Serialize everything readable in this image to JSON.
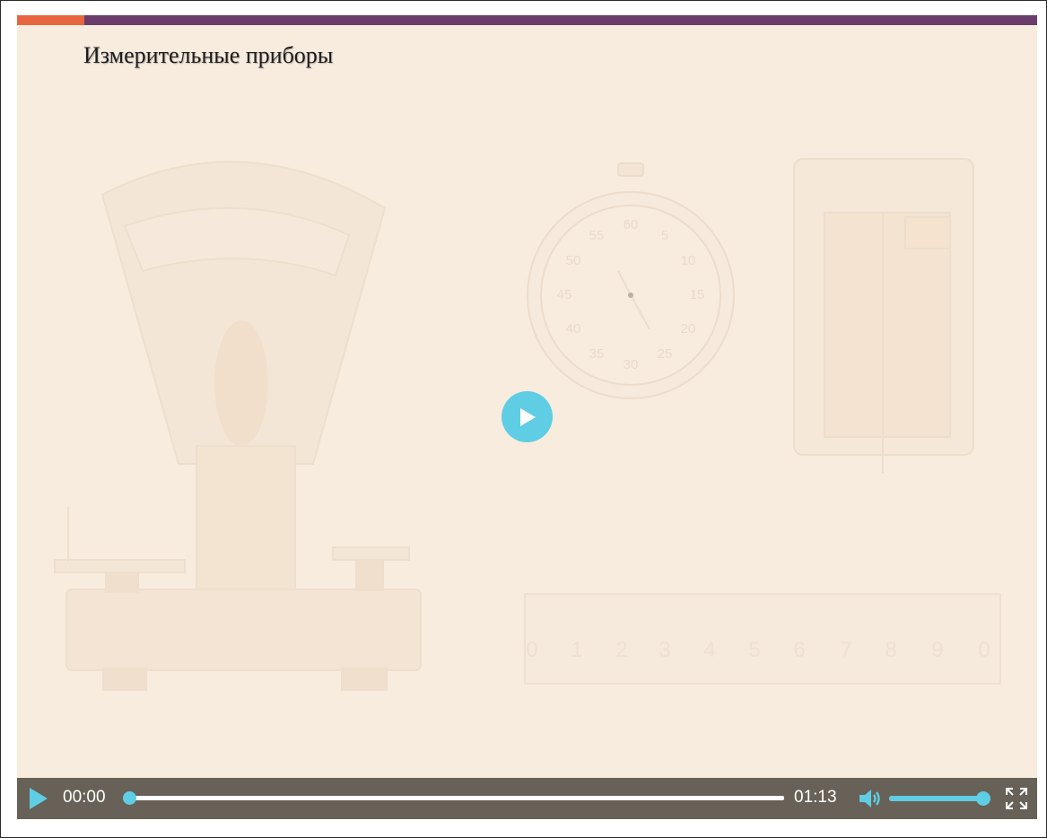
{
  "slide": {
    "title": "Измерительные приборы",
    "stopwatch_numbers": [
      "60",
      "5",
      "10",
      "15",
      "20",
      "25",
      "30",
      "35",
      "40",
      "45",
      "50",
      "55"
    ],
    "ruler_numbers": [
      "0",
      "1",
      "2",
      "3",
      "4",
      "5",
      "6",
      "7",
      "8",
      "9",
      "0"
    ]
  },
  "player": {
    "current_time": "00:00",
    "duration": "01:13",
    "progress_fraction": 0.0,
    "volume_fraction": 1.0,
    "big_play_icon": "play-icon",
    "play_icon": "play-icon",
    "volume_icon": "volume-icon",
    "fullscreen_icon": "fullscreen-icon"
  },
  "colors": {
    "accent": "#5fcde4",
    "bar_purple": "#6a3d6b",
    "bar_orange": "#e8663f",
    "controls_bg": "#676157",
    "slide_bg": "#f8ecdf"
  }
}
